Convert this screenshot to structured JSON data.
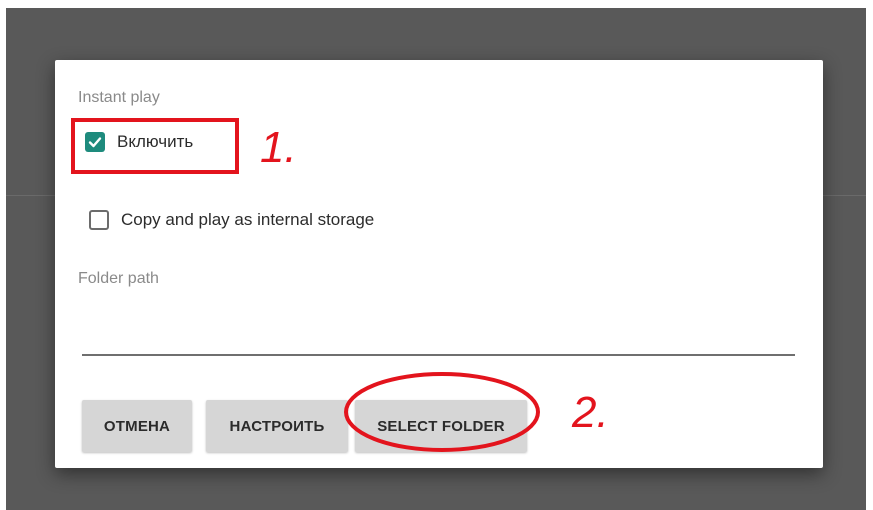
{
  "dialog": {
    "section_title": "Instant play",
    "enable_checkbox": {
      "label": "Включить",
      "checked": true
    },
    "copy_checkbox": {
      "label": "Copy and play as internal storage",
      "checked": false
    },
    "folder_path_label": "Folder path",
    "folder_path_value": "",
    "buttons": {
      "cancel": "ОТМЕНА",
      "configure": "НАСТРОИТЬ",
      "select_folder": "SELECT FOLDER"
    }
  },
  "annotations": {
    "step1": "1.",
    "step2": "2."
  },
  "colors": {
    "accent": "#1e8b7d",
    "annotation_red": "#e3141d",
    "backdrop": "#595959",
    "button_bg": "#d6d6d6"
  },
  "icons": {
    "checked": "check-icon"
  }
}
